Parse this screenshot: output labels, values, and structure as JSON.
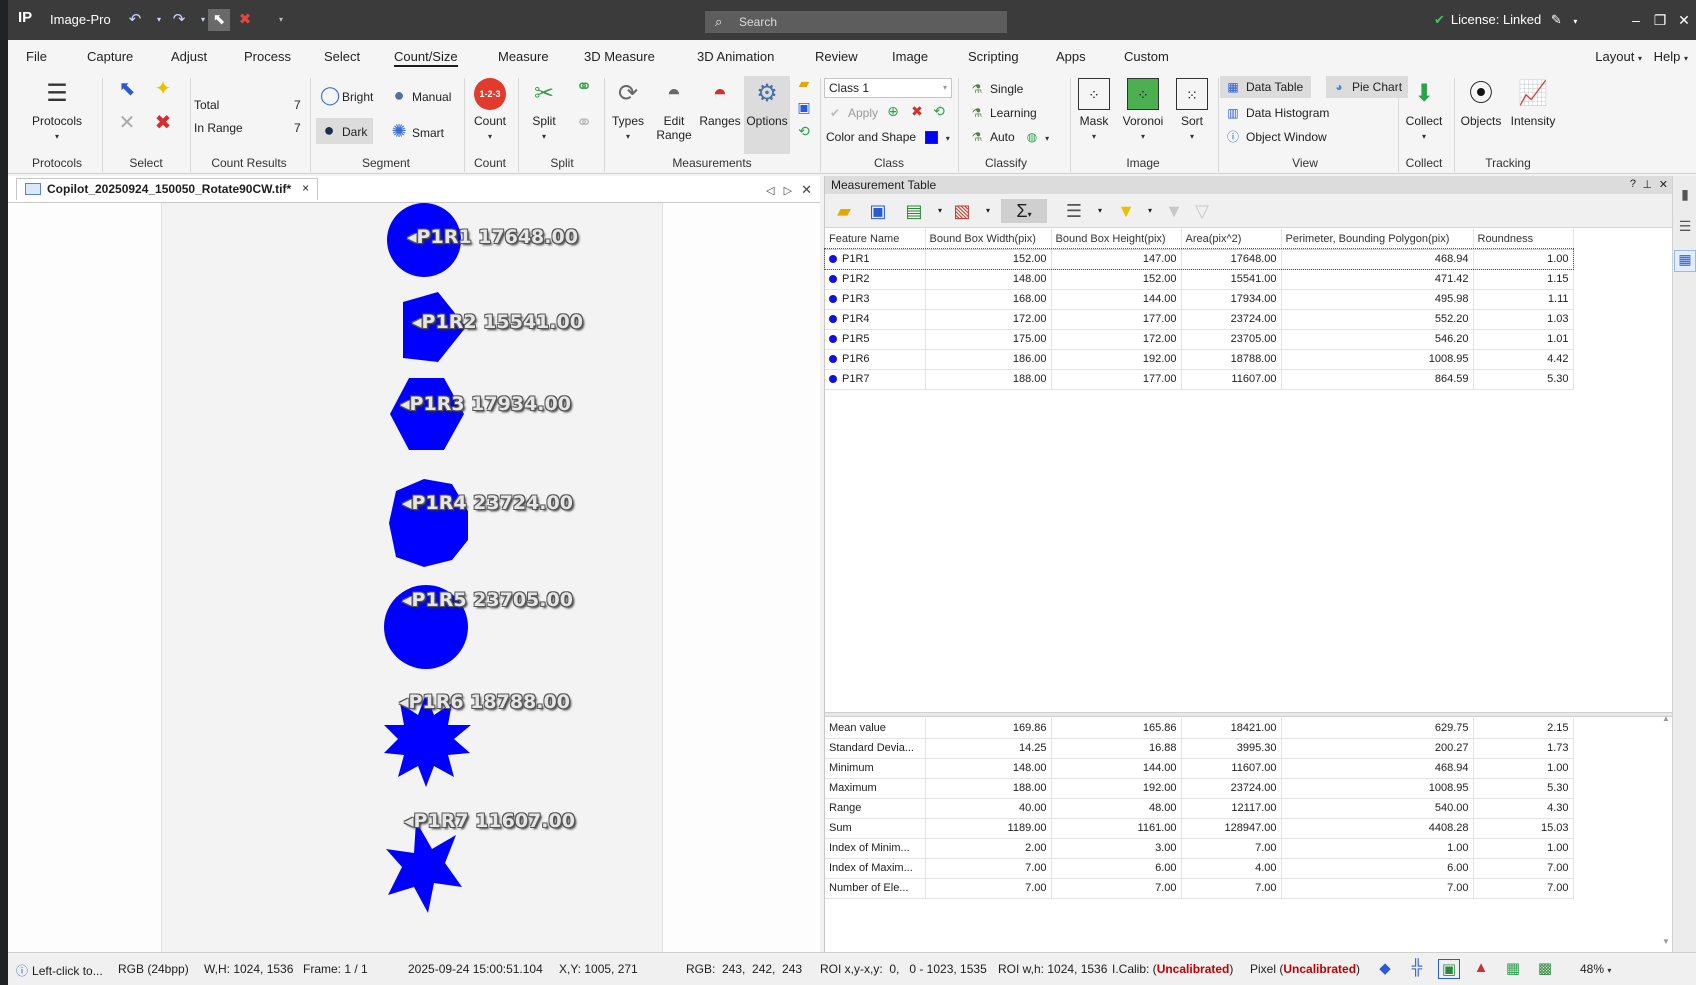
{
  "app": {
    "name": "Image-Pro",
    "search_placeholder": "Search",
    "license_text": "License: Linked"
  },
  "menu": [
    "File",
    "Capture",
    "Adjust",
    "Process",
    "Select",
    "Count/Size",
    "Measure",
    "3D Measure",
    "3D Animation",
    "Review",
    "Image",
    "Scripting",
    "Apps",
    "Custom"
  ],
  "menu_right": {
    "layout": "Layout",
    "help": "Help"
  },
  "ribbon": {
    "protocols": {
      "button": "Protocols",
      "group": "Protocols"
    },
    "select": {
      "group": "Select"
    },
    "count_results": {
      "total_label": "Total",
      "total_value": "7",
      "inrange_label": "In Range",
      "inrange_value": "7",
      "group": "Count Results"
    },
    "segment": {
      "bright": "Bright",
      "manual": "Manual",
      "dark": "Dark",
      "smart": "Smart",
      "group": "Segment"
    },
    "count": {
      "button": "Count",
      "badge": "1-2-3",
      "group": "Count"
    },
    "split": {
      "button": "Split",
      "group": "Split"
    },
    "measurements": {
      "types": "Types",
      "edit_range_1": "Edit",
      "edit_range_2": "Range",
      "ranges": "Ranges",
      "options": "Options",
      "group": "Measurements"
    },
    "class": {
      "selected": "Class 1",
      "apply": "Apply",
      "color_shape": "Color and Shape",
      "group": "Class"
    },
    "classify": {
      "single": "Single",
      "learning": "Learning",
      "auto": "Auto",
      "group": "Classify"
    },
    "image": {
      "mask": "Mask",
      "voronoi": "Voronoi",
      "sort": "Sort",
      "group": "Image"
    },
    "view": {
      "data_table": "Data Table",
      "pie_chart": "Pie Chart",
      "data_histogram": "Data Histogram",
      "object_window": "Object Window",
      "group": "View"
    },
    "collect": {
      "button": "Collect",
      "group": "Collect"
    },
    "tracking": {
      "objects": "Objects",
      "intensity": "Intensity",
      "group": "Tracking"
    }
  },
  "image_doc": {
    "tab_title": "Copilot_20250924_150050_Rotate90CW.tif*",
    "objects": [
      {
        "label": "P1R1 17648.00",
        "shape": "circle"
      },
      {
        "label": "P1R2 15541.00",
        "shape": "pentagon"
      },
      {
        "label": "P1R3 17934.00",
        "shape": "hexagon"
      },
      {
        "label": "P1R4 23724.00",
        "shape": "heptagon"
      },
      {
        "label": "P1R5 23705.00",
        "shape": "circle"
      },
      {
        "label": "P1R6 18788.00",
        "shape": "star12"
      },
      {
        "label": "P1R7 11607.00",
        "shape": "star6"
      }
    ],
    "object_color": "#0000ff"
  },
  "measurement_table": {
    "title": "Measurement Table",
    "columns": [
      "Feature Name",
      "Bound Box Width(pix)",
      "Bound Box Height(pix)",
      "Area(pix^2)",
      "Perimeter, Bounding Polygon(pix)",
      "Roundness"
    ],
    "rows": [
      [
        "P1R1",
        "152.00",
        "147.00",
        "17648.00",
        "468.94",
        "1.00"
      ],
      [
        "P1R2",
        "148.00",
        "152.00",
        "15541.00",
        "471.42",
        "1.15"
      ],
      [
        "P1R3",
        "168.00",
        "144.00",
        "17934.00",
        "495.98",
        "1.11"
      ],
      [
        "P1R4",
        "172.00",
        "177.00",
        "23724.00",
        "552.20",
        "1.03"
      ],
      [
        "P1R5",
        "175.00",
        "172.00",
        "23705.00",
        "546.20",
        "1.01"
      ],
      [
        "P1R6",
        "186.00",
        "192.00",
        "18788.00",
        "1008.95",
        "4.42"
      ],
      [
        "P1R7",
        "188.00",
        "177.00",
        "11607.00",
        "864.59",
        "5.30"
      ]
    ],
    "stats": [
      [
        "Mean value",
        "169.86",
        "165.86",
        "18421.00",
        "629.75",
        "2.15"
      ],
      [
        "Standard Devia...",
        "14.25",
        "16.88",
        "3995.30",
        "200.27",
        "1.73"
      ],
      [
        "Minimum",
        "148.00",
        "144.00",
        "11607.00",
        "468.94",
        "1.00"
      ],
      [
        "Maximum",
        "188.00",
        "192.00",
        "23724.00",
        "1008.95",
        "5.30"
      ],
      [
        "Range",
        "40.00",
        "48.00",
        "12117.00",
        "540.00",
        "4.30"
      ],
      [
        "Sum",
        "1189.00",
        "1161.00",
        "128947.00",
        "4408.28",
        "15.03"
      ],
      [
        "Index of Minim...",
        "2.00",
        "3.00",
        "7.00",
        "1.00",
        "1.00"
      ],
      [
        "Index of Maxim...",
        "7.00",
        "6.00",
        "4.00",
        "6.00",
        "7.00"
      ],
      [
        "Number of Ele...",
        "7.00",
        "7.00",
        "7.00",
        "7.00",
        "7.00"
      ]
    ]
  },
  "status": {
    "hint": "Left-click to...",
    "color_mode": "RGB (24bpp)",
    "wh": "W,H: 1024, 1536",
    "frame": "Frame: 1 / 1",
    "datetime": "2025-09-24 15:00:51.104",
    "xy": "X,Y: 1005, 271",
    "rgb": "RGB:  243,  242,  243",
    "roi_xy": "ROI x,y-x,y:  0,   0 - 1023, 1535",
    "roi_wh": "ROI w,h: 1024, 1536",
    "icalib_label": "I.Calib: (",
    "icalib_value": "Uncalibrated",
    "pixel_label": "Pixel (",
    "pixel_value": "Uncalibrated",
    "close_paren": ")",
    "zoom": "48%"
  }
}
